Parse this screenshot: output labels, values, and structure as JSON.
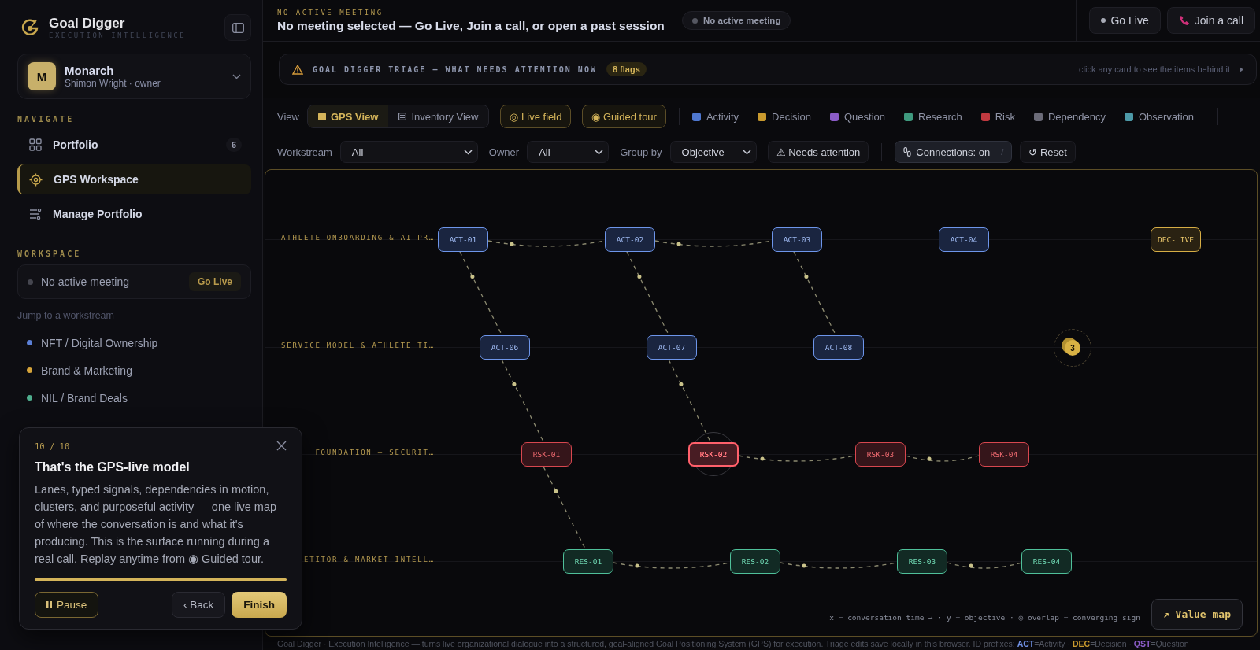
{
  "brand": {
    "name": "Goal Digger",
    "tagline": "EXECUTION INTELLIGENCE"
  },
  "org": {
    "initial": "M",
    "name": "Monarch",
    "subtitle": "Shimon Wright · owner"
  },
  "nav": {
    "heading": "NAVIGATE",
    "items": [
      {
        "label": "Portfolio",
        "kind": "grid",
        "badge": "6",
        "selected": false
      },
      {
        "label": "GPS Workspace",
        "kind": "target",
        "selected": true
      },
      {
        "label": "Manage Portfolio",
        "kind": "sliders",
        "selected": false
      }
    ]
  },
  "workspace": {
    "heading": "WORKSPACE",
    "meeting_status": "No active meeting",
    "go_live": "Go Live",
    "jump_label": "Jump to a workstream",
    "workstreams": [
      {
        "label": "NFT / Digital Ownership",
        "color": "#5b7fd6"
      },
      {
        "label": "Brand & Marketing",
        "color": "#d6a43a"
      },
      {
        "label": "NIL / Brand Deals",
        "color": "#4fae8e"
      }
    ]
  },
  "header": {
    "eyebrow": "NO ACTIVE MEETING",
    "title": "No meeting selected — Go Live, Join a call, or open a past session",
    "status_pill": "No active meeting",
    "buttons": [
      {
        "label": "Go Live",
        "kind": "live"
      },
      {
        "label": "Join a call",
        "kind": "call"
      }
    ]
  },
  "triage": {
    "title": "GOAL DIGGER TRIAGE — WHAT NEEDS ATTENTION NOW",
    "flags": "8 flags",
    "hint": "click any card to see the items behind it"
  },
  "view": {
    "label": "View",
    "tabs": [
      {
        "label": "GPS View",
        "kind": "map",
        "selected": true
      },
      {
        "label": "Inventory View",
        "kind": "list",
        "selected": false
      }
    ],
    "toggles": [
      "◎ Live field",
      "◉ Guided tour"
    ],
    "legend": [
      {
        "label": "Activity",
        "color": "#4f78d0"
      },
      {
        "label": "Decision",
        "color": "#c99a2e"
      },
      {
        "label": "Question",
        "color": "#8b5cc7"
      },
      {
        "label": "Research",
        "color": "#3f9a7e"
      },
      {
        "label": "Risk",
        "color": "#c0393f"
      },
      {
        "label": "Dependency",
        "color": "#6b6b78"
      },
      {
        "label": "Observation",
        "color": "#4d9aa8"
      }
    ]
  },
  "filters": [
    {
      "label": "Workstream",
      "value": "All"
    },
    {
      "label": "Owner",
      "value": "All"
    },
    {
      "label": "Group by",
      "value": "Objective"
    }
  ],
  "actions": [
    {
      "label": "⚠ Needs attention",
      "kind": "attention",
      "active": false
    },
    {
      "label": "Connections: on",
      "kind": "connections",
      "active": true,
      "shortcut": "/"
    },
    {
      "label": "↺ Reset",
      "kind": "reset",
      "active": false
    }
  ],
  "canvas": {
    "lanes": [
      {
        "label": "ATHLETE ONBOARDING & AI PR…",
        "nodes": [
          {
            "id": "ACT-01",
            "kind": "activity",
            "focused": false
          },
          {
            "id": "ACT-02",
            "kind": "activity",
            "focused": false
          },
          {
            "id": "ACT-03",
            "kind": "activity",
            "focused": false
          },
          {
            "id": "ACT-04",
            "kind": "activity",
            "focused": false
          },
          {
            "id": "DEC-LIVE",
            "kind": "decision",
            "focused": false
          }
        ]
      },
      {
        "label": "SERVICE MODEL & ATHLETE TI…",
        "nodes": [
          {
            "id": "ACT-06",
            "kind": "activity",
            "focused": false
          },
          {
            "id": "ACT-07",
            "kind": "activity",
            "focused": false
          },
          {
            "id": "ACT-08",
            "kind": "activity",
            "focused": false
          }
        ],
        "cluster": "3"
      },
      {
        "label": "FOUNDATION — SECURIT…",
        "nodes": [
          {
            "id": "RSK-01",
            "kind": "risk",
            "focused": false
          },
          {
            "id": "RSK-02",
            "kind": "risk",
            "focused": true
          },
          {
            "id": "RSK-03",
            "kind": "risk",
            "focused": false
          },
          {
            "id": "RSK-04",
            "kind": "risk",
            "focused": false
          }
        ]
      },
      {
        "label": "ETITOR & MARKET INTELL…",
        "nodes": [
          {
            "id": "RES-01",
            "kind": "research",
            "focused": false
          },
          {
            "id": "RES-02",
            "kind": "research",
            "focused": false
          },
          {
            "id": "RES-03",
            "kind": "research",
            "focused": false
          },
          {
            "id": "RES-04",
            "kind": "research",
            "focused": false
          }
        ]
      }
    ],
    "axis_note": "x = conversation time → · y = objective · ◎ overlap = converging sign",
    "value_map": "↗ Value map"
  },
  "footer": "Goal Digger · Execution Intelligence — turns live organizational dialogue into a structured, goal-aligned Goal Positioning System (GPS) for execution. Triage edits save locally in this browser. ID prefixes: **ACT**=Activity · **DEC**=Decision · **QST**=Question",
  "tour": {
    "step": "10 / 10",
    "title": "That's the GPS-live model",
    "body": "Lanes, typed signals, dependencies in motion, clusters, and purposeful activity — one live map of where the conversation is and what it's producing. This is the surface running during a real call. Replay anytime from ◉ Guided tour.",
    "level": 1,
    "pause": "Pause",
    "back": "‹ Back",
    "finish": "Finish"
  }
}
